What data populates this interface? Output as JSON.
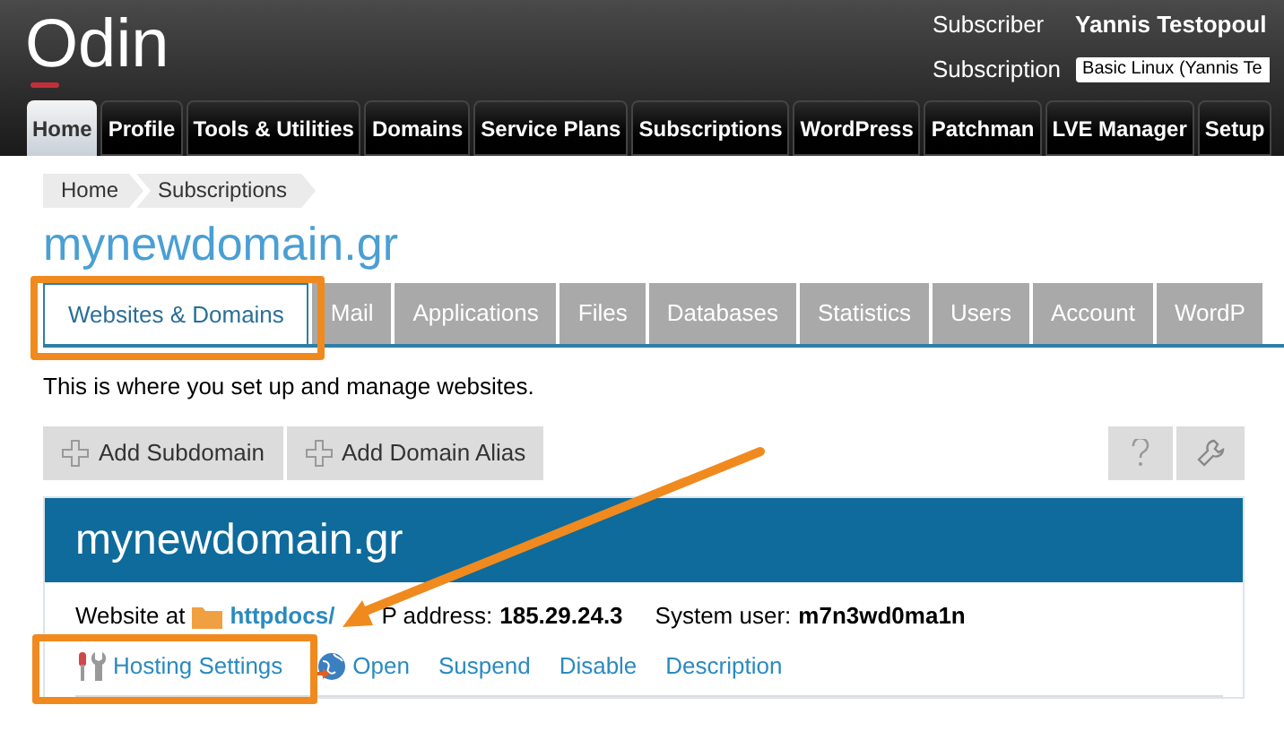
{
  "header": {
    "logo": "Odin",
    "subscriber_label": "Subscriber",
    "subscriber_name": "Yannis Testopoul",
    "subscription_label": "Subscription",
    "subscription_value": "Basic Linux (Yannis Te"
  },
  "nav_tabs": [
    {
      "label": "Home",
      "selected": true
    },
    {
      "label": "Profile",
      "selected": false
    },
    {
      "label": "Tools & Utilities",
      "selected": false
    },
    {
      "label": "Domains",
      "selected": false
    },
    {
      "label": "Service Plans",
      "selected": false
    },
    {
      "label": "Subscriptions",
      "selected": false
    },
    {
      "label": "WordPress",
      "selected": false
    },
    {
      "label": "Patchman",
      "selected": false
    },
    {
      "label": "LVE Manager",
      "selected": false
    },
    {
      "label": "Setup",
      "selected": false
    }
  ],
  "breadcrumb": [
    "Home",
    "Subscriptions"
  ],
  "page_title": "mynewdomain.gr",
  "tabs": [
    {
      "label": "Websites & Domains",
      "selected": true
    },
    {
      "label": "Mail",
      "selected": false
    },
    {
      "label": "Applications",
      "selected": false
    },
    {
      "label": "Files",
      "selected": false
    },
    {
      "label": "Databases",
      "selected": false
    },
    {
      "label": "Statistics",
      "selected": false
    },
    {
      "label": "Users",
      "selected": false
    },
    {
      "label": "Account",
      "selected": false
    },
    {
      "label": "WordP",
      "selected": false
    }
  ],
  "description": "This is where you set up and manage websites.",
  "toolbar": {
    "buttons": [
      "Add Subdomain",
      "Add Domain Alias"
    ]
  },
  "domain": {
    "name": "mynewdomain.gr",
    "website_label": "Website at",
    "docroot": "httpdocs/",
    "ip_label": "P address:",
    "ip": "185.29.24.3",
    "user_label": "System user:",
    "user": "m7n3wd0ma1n",
    "actions": [
      {
        "label": "Hosting Settings",
        "kind": "settings"
      },
      {
        "label": "Open",
        "kind": "open"
      },
      {
        "label": "Suspend",
        "kind": "plain"
      },
      {
        "label": "Disable",
        "kind": "plain"
      },
      {
        "label": "Description",
        "kind": "plain"
      }
    ]
  }
}
